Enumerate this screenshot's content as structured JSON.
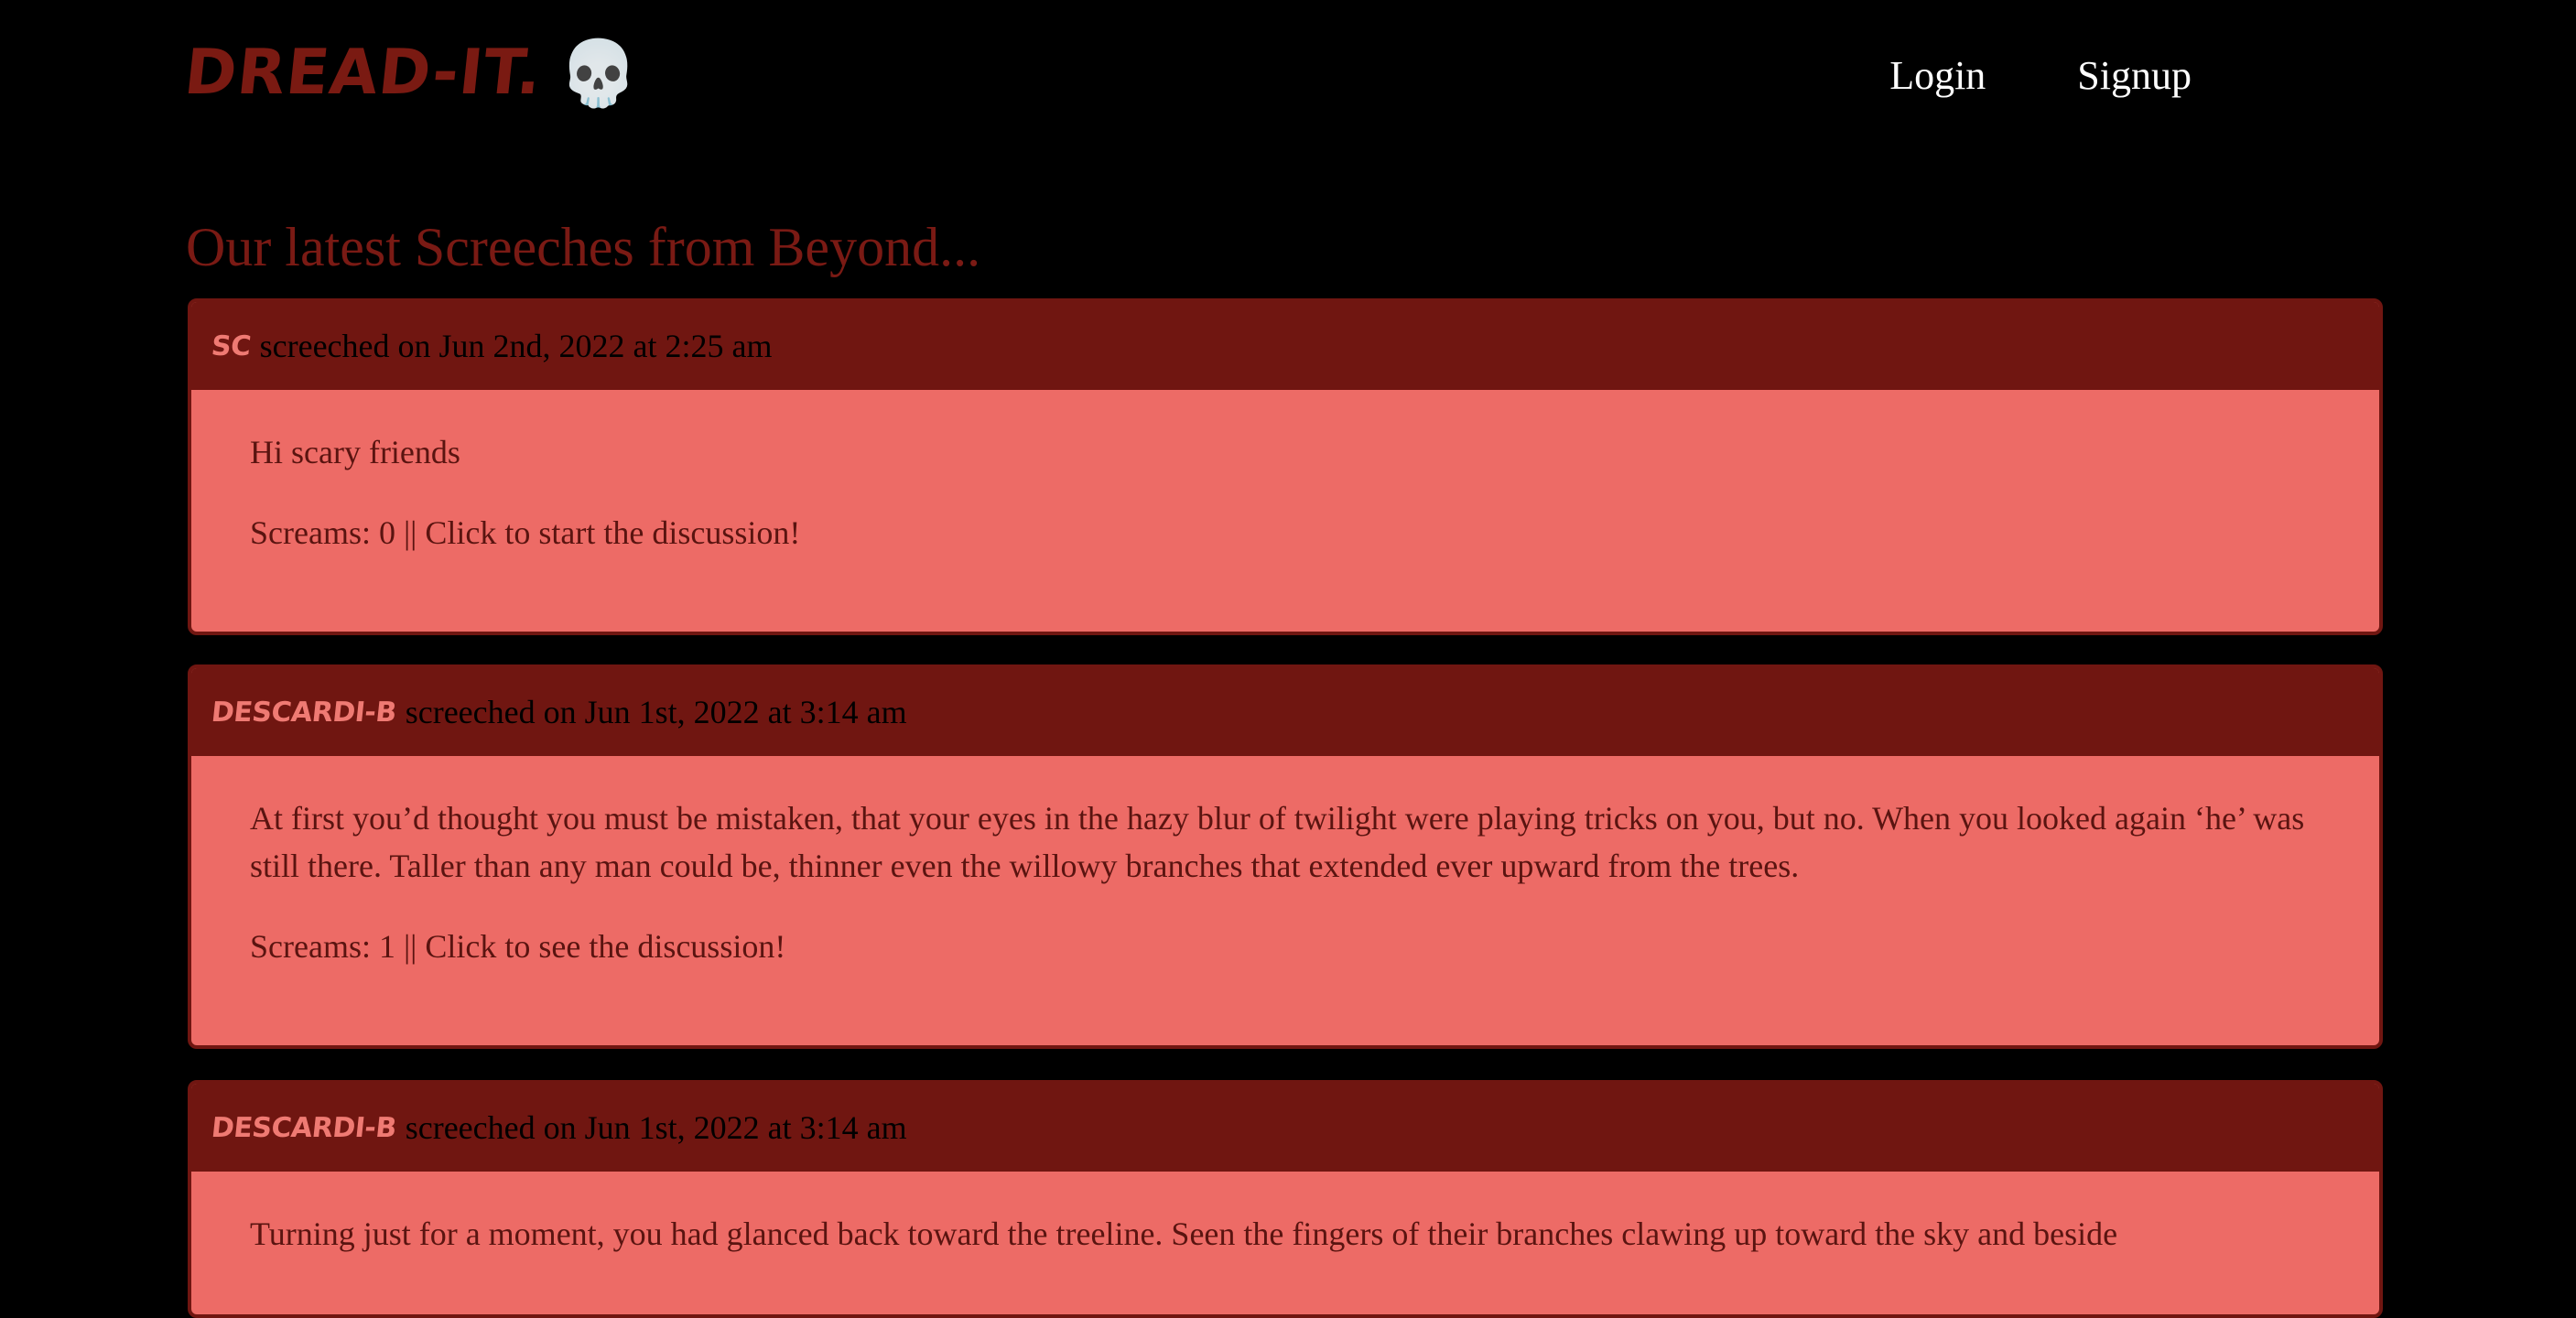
{
  "brand": {
    "name": "Dread-It.",
    "icon": "skull-icon",
    "icon_glyph": "💀"
  },
  "nav": {
    "login_label": "Login",
    "signup_label": "Signup"
  },
  "page_title": "Our latest Screeches from Beyond...",
  "colors": {
    "background": "#000000",
    "header_bar": "#701611",
    "card": "#ed6b66",
    "accent": "#7a1a12"
  },
  "posts": [
    {
      "author": "SC",
      "meta": "screeched on Jun 2nd, 2022 at 2:25 am",
      "body": "Hi scary friends",
      "screams": "Screams: 0 || Click to start the discussion!"
    },
    {
      "author": "descardi-b",
      "meta": "screeched on Jun 1st, 2022 at 3:14 am",
      "body": "At first you’d thought you must be mistaken, that your eyes in the hazy blur of twilight were playing tricks on you, but no. When you looked again ‘he’ was still there. Taller than any man could be, thinner even the willowy branches that extended ever upward from the trees.",
      "screams": "Screams: 1 || Click to see the discussion!"
    },
    {
      "author": "descardi-b",
      "meta": "screeched on Jun 1st, 2022 at 3:14 am",
      "body": "Turning just for a moment, you had glanced back toward the treeline. Seen the fingers of their branches clawing up toward the sky and beside"
    }
  ]
}
